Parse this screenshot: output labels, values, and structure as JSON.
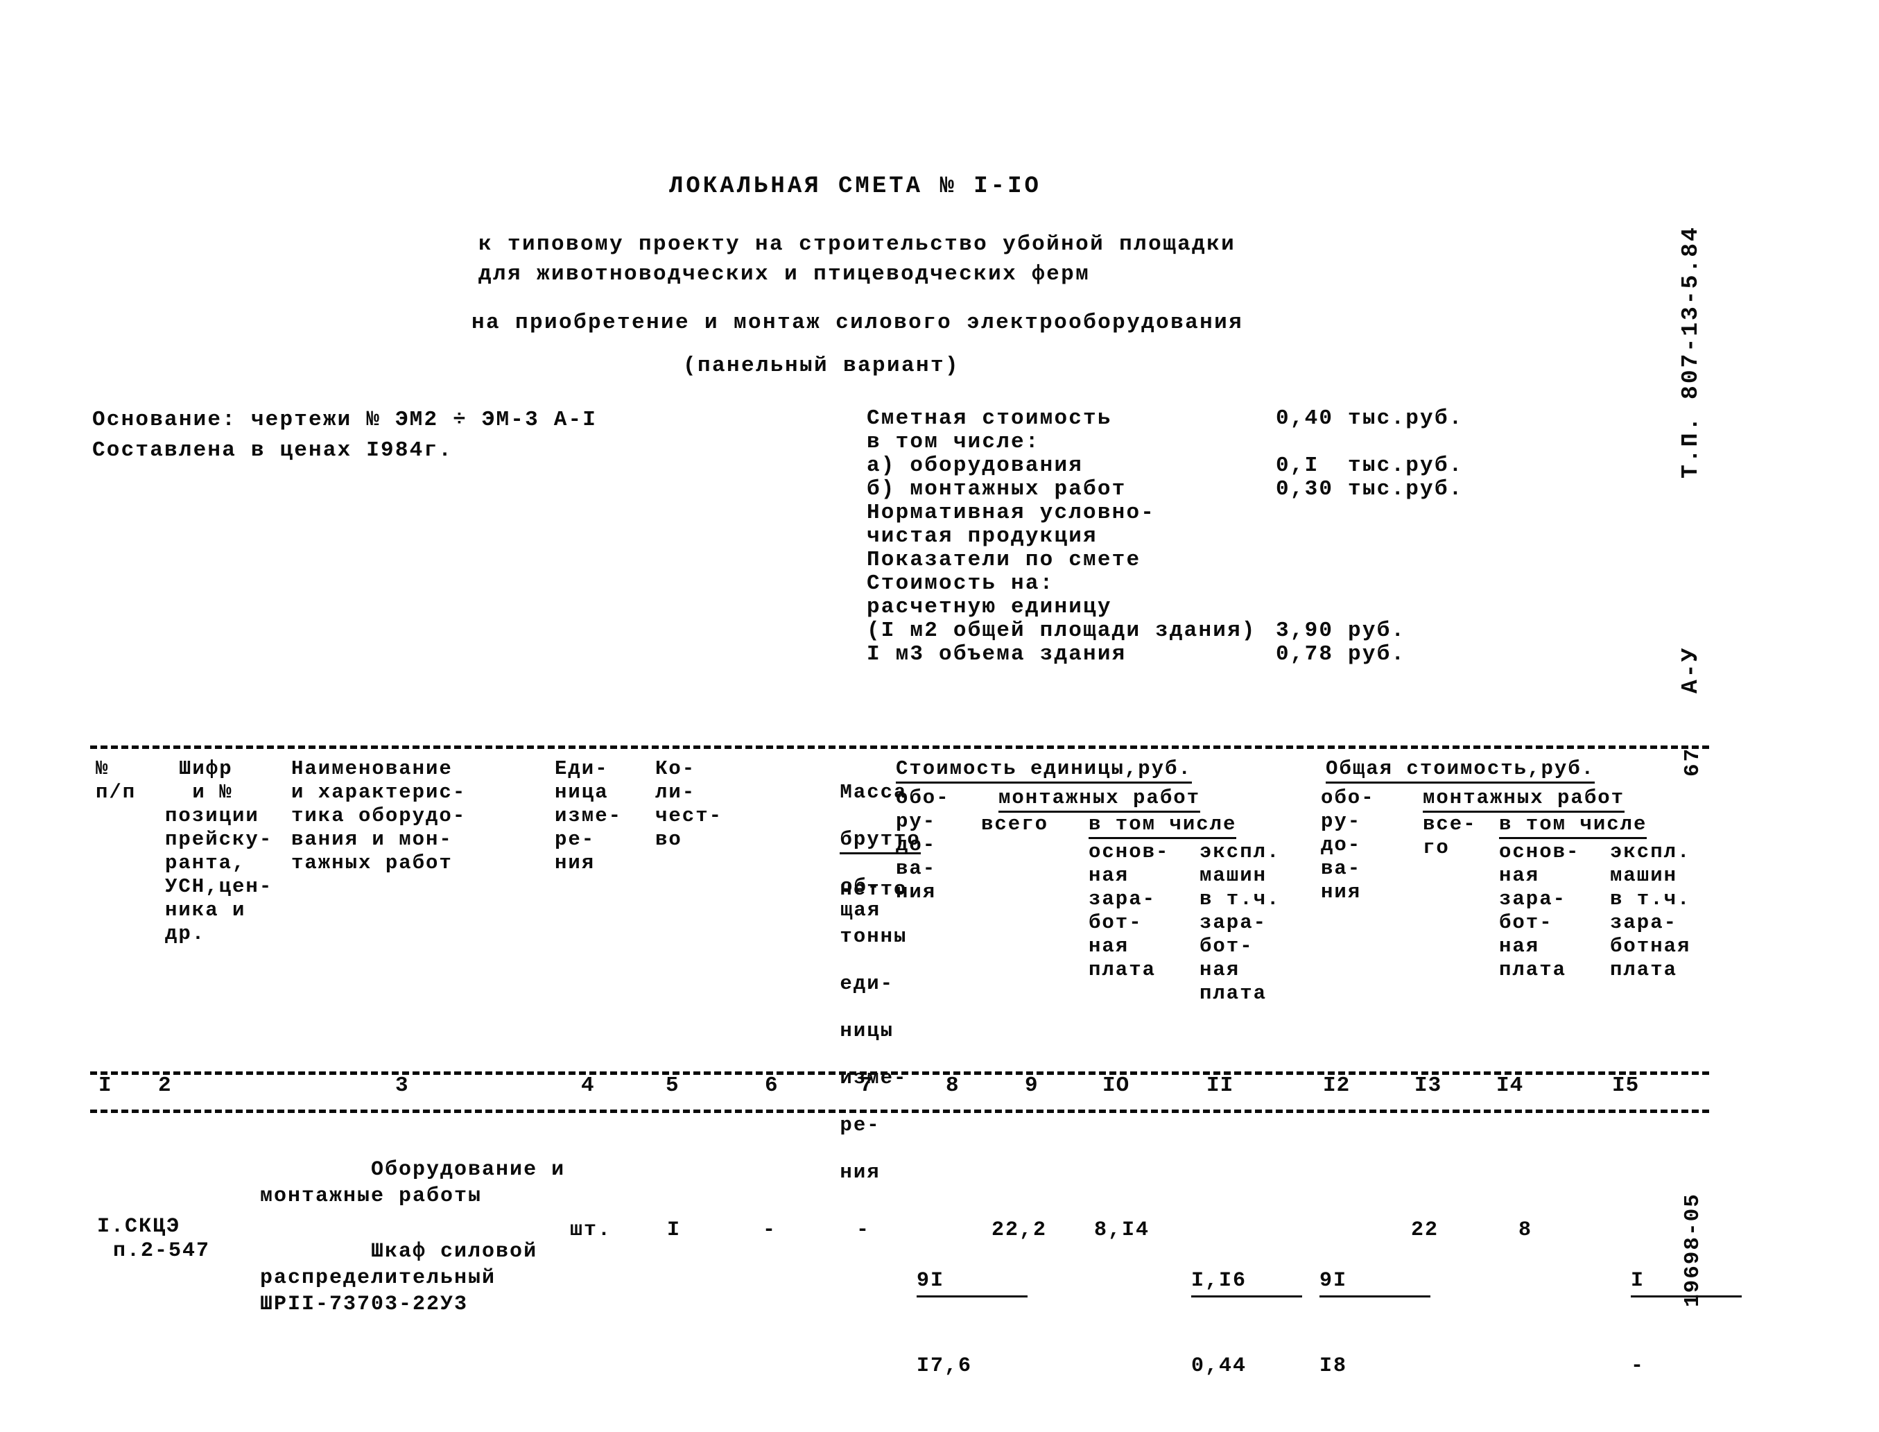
{
  "document": {
    "title": "ЛОКАЛЬНАЯ СМЕТА № I-IO",
    "subtitle_line1": "к типовому проекту на строительство убойной площадки",
    "subtitle_line2": "для животноводческих и птицеводческих ферм",
    "subtitle_line3": "на приобретение и монтаж силового электрооборудования",
    "subtitle_line4": "(панельный вариант)"
  },
  "basis": {
    "line1": "Основание: чертежи № ЭМ2 ÷ ЭМ-3 А-I",
    "line2": "Составлена в ценах I984г."
  },
  "cost_summary": [
    {
      "label": "Сметная стоимость",
      "value": "0,40 тыс.руб."
    },
    {
      "label": "в том числе:",
      "value": ""
    },
    {
      "label": "а) оборудования",
      "value": "0,I  тыс.руб."
    },
    {
      "label": "б) монтажных работ",
      "value": "0,30 тыс.руб."
    },
    {
      "label": "Нормативная условно-",
      "value": ""
    },
    {
      "label": "чистая продукция",
      "value": ""
    },
    {
      "label": "Показатели по смете",
      "value": ""
    },
    {
      "label": "Стоимость на:",
      "value": ""
    },
    {
      "label": "расчетную единицу",
      "value": ""
    },
    {
      "label": "(I м2 общей площади здания)",
      "value": "3,90 руб."
    },
    {
      "label": "I м3 объема здания",
      "value": "0,78 руб."
    }
  ],
  "table_header": {
    "col1": [
      "№",
      "п/п"
    ],
    "col2": [
      "Шифр",
      "и №",
      "позиции",
      "прейску-",
      "ранта,",
      "УСН,цен-",
      "ника и",
      "др."
    ],
    "col3": [
      "Наименование",
      "и характерис-",
      "тика оборудо-",
      "вания и мон-",
      "тажных работ"
    ],
    "col4": [
      "Еди-",
      "ница",
      "изме-",
      "ре-",
      "ния"
    ],
    "col5": [
      "Ко-",
      "ли-",
      "чест-",
      "во"
    ],
    "col6": [
      "Масса",
      "брутто",
      "нетто",
      "тонны",
      "еди-",
      "ницы",
      "изме-",
      "ре-",
      "ния"
    ],
    "col7": [
      "об-",
      "щая"
    ],
    "group_unit_cost": "Стоимость единицы,руб.",
    "col8": [
      "обо-",
      "ру-",
      "до-",
      "ва-",
      "ния"
    ],
    "sub_mount_unit": "монтажных работ",
    "col9": [
      "всего"
    ],
    "sub_in_which_unit": "в том числе",
    "col10": [
      "основ-",
      "ная",
      "зара-",
      "бот-",
      "ная",
      "плата"
    ],
    "col11": [
      "экспл.",
      "машин",
      "в т.ч.",
      "зара-",
      "бот-",
      "ная",
      "плата"
    ],
    "group_total_cost": "Общая стоимость,руб.",
    "col12": [
      "обо-",
      "ру-",
      "до-",
      "ва-",
      "ния"
    ],
    "sub_mount_total": "монтажных работ",
    "col13": [
      "все-",
      "го"
    ],
    "sub_in_which_total": "в том числе",
    "col14": [
      "основ-",
      "ная",
      "зара-",
      "бот-",
      "ная",
      "плата"
    ],
    "col15": [
      "экспл.",
      "машин",
      "в т.ч.",
      "зара-",
      "ботная",
      "плата"
    ]
  },
  "column_numbers": [
    "I",
    "2",
    "3",
    "4",
    "5",
    "6",
    "7",
    "8",
    "9",
    "IO",
    "II",
    "I2",
    "I3",
    "I4",
    "I5"
  ],
  "rows": [
    {
      "kind": "section",
      "name_line1": "Оборудование и",
      "name_line2": "монтажные работы"
    },
    {
      "kind": "item",
      "num": "I.СКЦЭ",
      "code": "п.2-547",
      "name_line1": "Шкаф силовой",
      "name_line2": "распределительный",
      "name_line3": "ШРII-73703-22У3",
      "unit": "шт.",
      "qty": "I",
      "mass_unit": "-",
      "mass_total": "-",
      "unit_equip_num": "9I",
      "unit_equip_den": "I7,6",
      "unit_mount_total": "22,2",
      "unit_mount_base": "8,I4",
      "unit_mount_mach_num": "I,I6",
      "unit_mount_mach_den": "0,44",
      "total_equip_num": "9I",
      "total_equip_den": "I8",
      "total_mount_all": "22",
      "total_mount_base": "8",
      "total_mount_mach_num": "I",
      "total_mount_mach_den": "-"
    }
  ],
  "margin": {
    "project_code": "Т.П. 807-13-5.84",
    "series": "А-У",
    "page": "67",
    "archive_code": "19698-05"
  }
}
